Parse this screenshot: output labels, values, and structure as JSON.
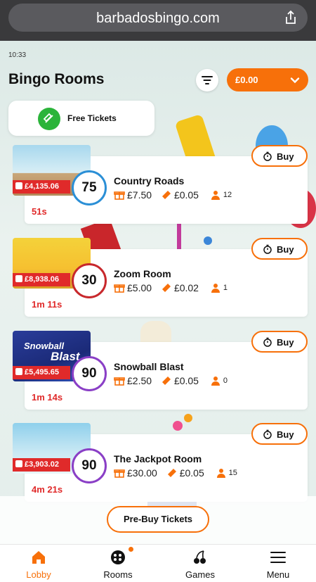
{
  "browser": {
    "url": "barbadosbingo.com"
  },
  "status": {
    "time": "10:33"
  },
  "header": {
    "title": "Bingo Rooms",
    "balance": "£0.00"
  },
  "free_tickets": {
    "label": "Free Tickets"
  },
  "rooms": [
    {
      "name": "Country Roads",
      "ball": "75",
      "ball_color": "#2b8fd6",
      "jackpot": "£4,135.06",
      "timer": "51s",
      "price": "£7.50",
      "ticket": "£0.05",
      "players": "12",
      "buy": "Buy"
    },
    {
      "name": "Zoom Room",
      "ball": "30",
      "ball_color": "#c8282c",
      "jackpot": "£8,938.06",
      "timer": "1m 11s",
      "price": "£5.00",
      "ticket": "£0.02",
      "players": "1",
      "buy": "Buy"
    },
    {
      "name": "Snowball Blast",
      "ball": "90",
      "ball_color": "#8a3fc6",
      "jackpot": "£5,495.65",
      "timer": "1m 14s",
      "price": "£2.50",
      "ticket": "£0.05",
      "players": "0",
      "buy": "Buy",
      "image_text": [
        "Snowball",
        "Blast"
      ]
    },
    {
      "name": "The Jackpot Room",
      "ball": "90",
      "ball_color": "#8a3fc6",
      "jackpot": "£3,903.02",
      "timer": "4m 21s",
      "price": "£30.00",
      "ticket": "£0.05",
      "players": "15",
      "buy": "Buy"
    }
  ],
  "prebuy": {
    "label": "Pre-Buy Tickets"
  },
  "nav": {
    "lobby": "Lobby",
    "rooms": "Rooms",
    "games": "Games",
    "menu": "Menu"
  },
  "colors": {
    "accent": "#f7700a",
    "jackpot_red": "#e02a2a",
    "green": "#2bb43a"
  }
}
